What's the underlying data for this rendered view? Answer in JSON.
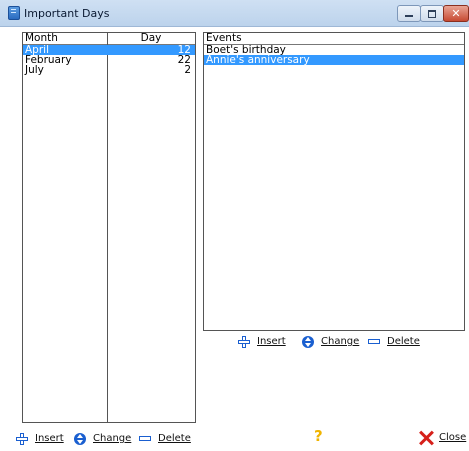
{
  "window": {
    "title": "Important Days",
    "controls": [
      "minimize-icon",
      "maximize-icon",
      "close-icon"
    ]
  },
  "left_list": {
    "headers": {
      "month": "Month",
      "day": "Day"
    },
    "rows": [
      {
        "month": "April",
        "day": "12",
        "selected": true
      },
      {
        "month": "February",
        "day": "22",
        "selected": false
      },
      {
        "month": "July",
        "day": "2",
        "selected": false
      }
    ]
  },
  "right_list": {
    "header": "Events",
    "rows": [
      {
        "text": "Boet's birthday",
        "selected": false
      },
      {
        "text": "Annie's anniversary",
        "selected": true
      }
    ]
  },
  "events_actions": {
    "insert": {
      "label": "Insert",
      "icon": "plus-icon"
    },
    "change": {
      "label": "Change",
      "icon": "change-icon"
    },
    "delete": {
      "label": "Delete",
      "icon": "minus-icon"
    }
  },
  "days_actions": {
    "insert": {
      "label": "Insert",
      "icon": "plus-icon"
    },
    "change": {
      "label": "Change",
      "icon": "change-icon"
    },
    "delete": {
      "label": "Delete",
      "icon": "minus-icon"
    }
  },
  "footer": {
    "help_glyph": "?",
    "close_label": "Close",
    "close_icon": "red-x-icon"
  },
  "colors": {
    "selection": "#3399ff",
    "action_icon": "#1a5fd0",
    "close_x": "#d6201a",
    "help": "#f0b400"
  }
}
